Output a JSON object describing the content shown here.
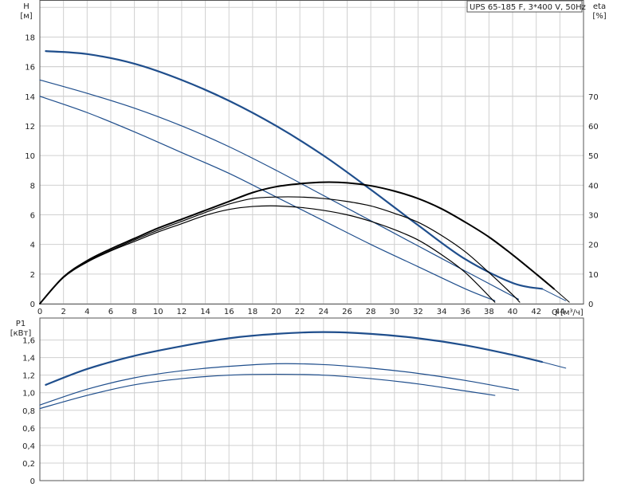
{
  "chart_data": [
    {
      "type": "line",
      "title": "UPS 65-185 F, 3*400 V, 50Hz",
      "xlabel": "Q [м³/ч]",
      "ylabel": "H",
      "ylabel_unit": "[м]",
      "y2label": "eta",
      "y2label_unit": "[%]",
      "xlim": [
        0,
        46
      ],
      "ylim": [
        0,
        20.5
      ],
      "y2lim": [
        0,
        102.5
      ],
      "x_ticks": [
        0,
        2,
        4,
        6,
        8,
        10,
        12,
        14,
        16,
        18,
        20,
        22,
        24,
        26,
        28,
        30,
        32,
        34,
        36,
        38,
        40,
        42,
        44
      ],
      "y_ticks": [
        0,
        2,
        4,
        6,
        8,
        10,
        12,
        14,
        16,
        18
      ],
      "y2_ticks": [
        0,
        10,
        20,
        30,
        40,
        50,
        60,
        70
      ],
      "grid": true,
      "series": [
        {
          "kind": "head",
          "axis": "y",
          "color": "#1f4e8c",
          "width": 2.2,
          "x": [
            0.5,
            4,
            8,
            12,
            16,
            20,
            24,
            28,
            32,
            36,
            40,
            42.5
          ],
          "y": [
            17.05,
            16.85,
            16.2,
            15.1,
            13.7,
            12.0,
            10.0,
            7.7,
            5.3,
            3.0,
            1.4,
            1.0
          ]
        },
        {
          "kind": "head-ext",
          "axis": "y",
          "color": "#1f4e8c",
          "width": 1,
          "x": [
            42.5,
            44.5
          ],
          "y": [
            1.0,
            0.2
          ]
        },
        {
          "kind": "head",
          "axis": "y",
          "color": "#1f4e8c",
          "width": 1.2,
          "x": [
            0,
            4,
            8,
            12,
            16,
            20,
            24,
            28,
            32,
            36,
            40.5
          ],
          "y": [
            15.1,
            14.2,
            13.2,
            12.0,
            10.6,
            9.0,
            7.3,
            5.6,
            3.9,
            2.2,
            0.3
          ]
        },
        {
          "kind": "head",
          "axis": "y",
          "color": "#1f4e8c",
          "width": 1.2,
          "x": [
            0,
            4,
            8,
            12,
            16,
            20,
            24,
            28,
            32,
            36,
            38.5
          ],
          "y": [
            14.0,
            12.9,
            11.6,
            10.2,
            8.8,
            7.2,
            5.6,
            4.0,
            2.5,
            1.0,
            0.2
          ]
        },
        {
          "kind": "eta",
          "axis": "y2",
          "color": "#000000",
          "width": 2,
          "x": [
            0,
            2,
            4,
            6,
            8,
            10,
            12,
            14,
            16,
            18,
            20,
            22,
            24,
            26,
            28,
            30,
            32,
            34,
            36,
            38,
            40,
            42,
            43.5
          ],
          "y": [
            0,
            9,
            14.5,
            18.5,
            22,
            25.5,
            28.5,
            31.5,
            34.5,
            37.5,
            39.5,
            40.5,
            41.0,
            40.8,
            39.8,
            38.0,
            35.5,
            32.0,
            27.5,
            22.5,
            16.5,
            10,
            5
          ]
        },
        {
          "kind": "eta-ext",
          "axis": "y2",
          "color": "#000000",
          "width": 1,
          "x": [
            43.5,
            44.8
          ],
          "y": [
            5,
            0.5
          ]
        },
        {
          "kind": "eta",
          "axis": "y2",
          "color": "#000000",
          "width": 1.2,
          "x": [
            0,
            2,
            4,
            6,
            8,
            10,
            12,
            14,
            16,
            18,
            20,
            22,
            24,
            26,
            28,
            30,
            32,
            34,
            36,
            38,
            40,
            40.6
          ],
          "y": [
            0,
            9,
            14.2,
            18.0,
            21.5,
            24.8,
            27.8,
            30.8,
            33.6,
            35.5,
            36.0,
            36.0,
            35.5,
            34.5,
            33.0,
            30.5,
            27.5,
            23.0,
            17.5,
            10.5,
            3,
            0.5
          ]
        },
        {
          "kind": "eta",
          "axis": "y2",
          "color": "#000000",
          "width": 1.2,
          "x": [
            0,
            2,
            4,
            6,
            8,
            10,
            12,
            14,
            16,
            18,
            20,
            22,
            24,
            26,
            28,
            30,
            32,
            34,
            36,
            38.5
          ],
          "y": [
            0,
            8.8,
            14.0,
            17.8,
            21.0,
            24.2,
            27.0,
            29.8,
            31.8,
            32.8,
            33.0,
            32.5,
            31.5,
            30.0,
            27.8,
            25.0,
            21.5,
            16.5,
            10.5,
            0.5
          ]
        }
      ]
    },
    {
      "type": "line",
      "title": "",
      "xlabel": "",
      "ylabel": "P1",
      "ylabel_unit": "[кВт]",
      "xlim": [
        0,
        46
      ],
      "ylim": [
        0,
        1.85
      ],
      "y_ticks": [
        0,
        0.2,
        0.4,
        0.6,
        0.8,
        1.0,
        1.2,
        1.4,
        1.6
      ],
      "y_tick_labels": [
        "0",
        "0,2",
        "0,4",
        "0,6",
        "0,8",
        "1,0",
        "1,2",
        "1,4",
        "1,6"
      ],
      "grid": true,
      "series": [
        {
          "kind": "power",
          "color": "#1f4e8c",
          "width": 2.2,
          "x": [
            0.5,
            4,
            8,
            12,
            16,
            20,
            24,
            28,
            32,
            36,
            40,
            42.5
          ],
          "y": [
            1.09,
            1.27,
            1.42,
            1.53,
            1.62,
            1.67,
            1.69,
            1.67,
            1.62,
            1.54,
            1.43,
            1.35
          ]
        },
        {
          "kind": "power-ext",
          "color": "#1f4e8c",
          "width": 1,
          "x": [
            42.5,
            44.5
          ],
          "y": [
            1.35,
            1.28
          ]
        },
        {
          "kind": "power",
          "color": "#1f4e8c",
          "width": 1.2,
          "x": [
            0,
            4,
            8,
            12,
            16,
            20,
            24,
            28,
            32,
            36,
            40.5
          ],
          "y": [
            0.86,
            1.04,
            1.17,
            1.25,
            1.3,
            1.33,
            1.32,
            1.28,
            1.22,
            1.14,
            1.03
          ]
        },
        {
          "kind": "power",
          "color": "#1f4e8c",
          "width": 1.2,
          "x": [
            0,
            4,
            8,
            12,
            16,
            20,
            24,
            28,
            32,
            36,
            38.5
          ],
          "y": [
            0.82,
            0.97,
            1.09,
            1.16,
            1.2,
            1.21,
            1.2,
            1.16,
            1.1,
            1.02,
            0.97
          ]
        }
      ]
    }
  ]
}
